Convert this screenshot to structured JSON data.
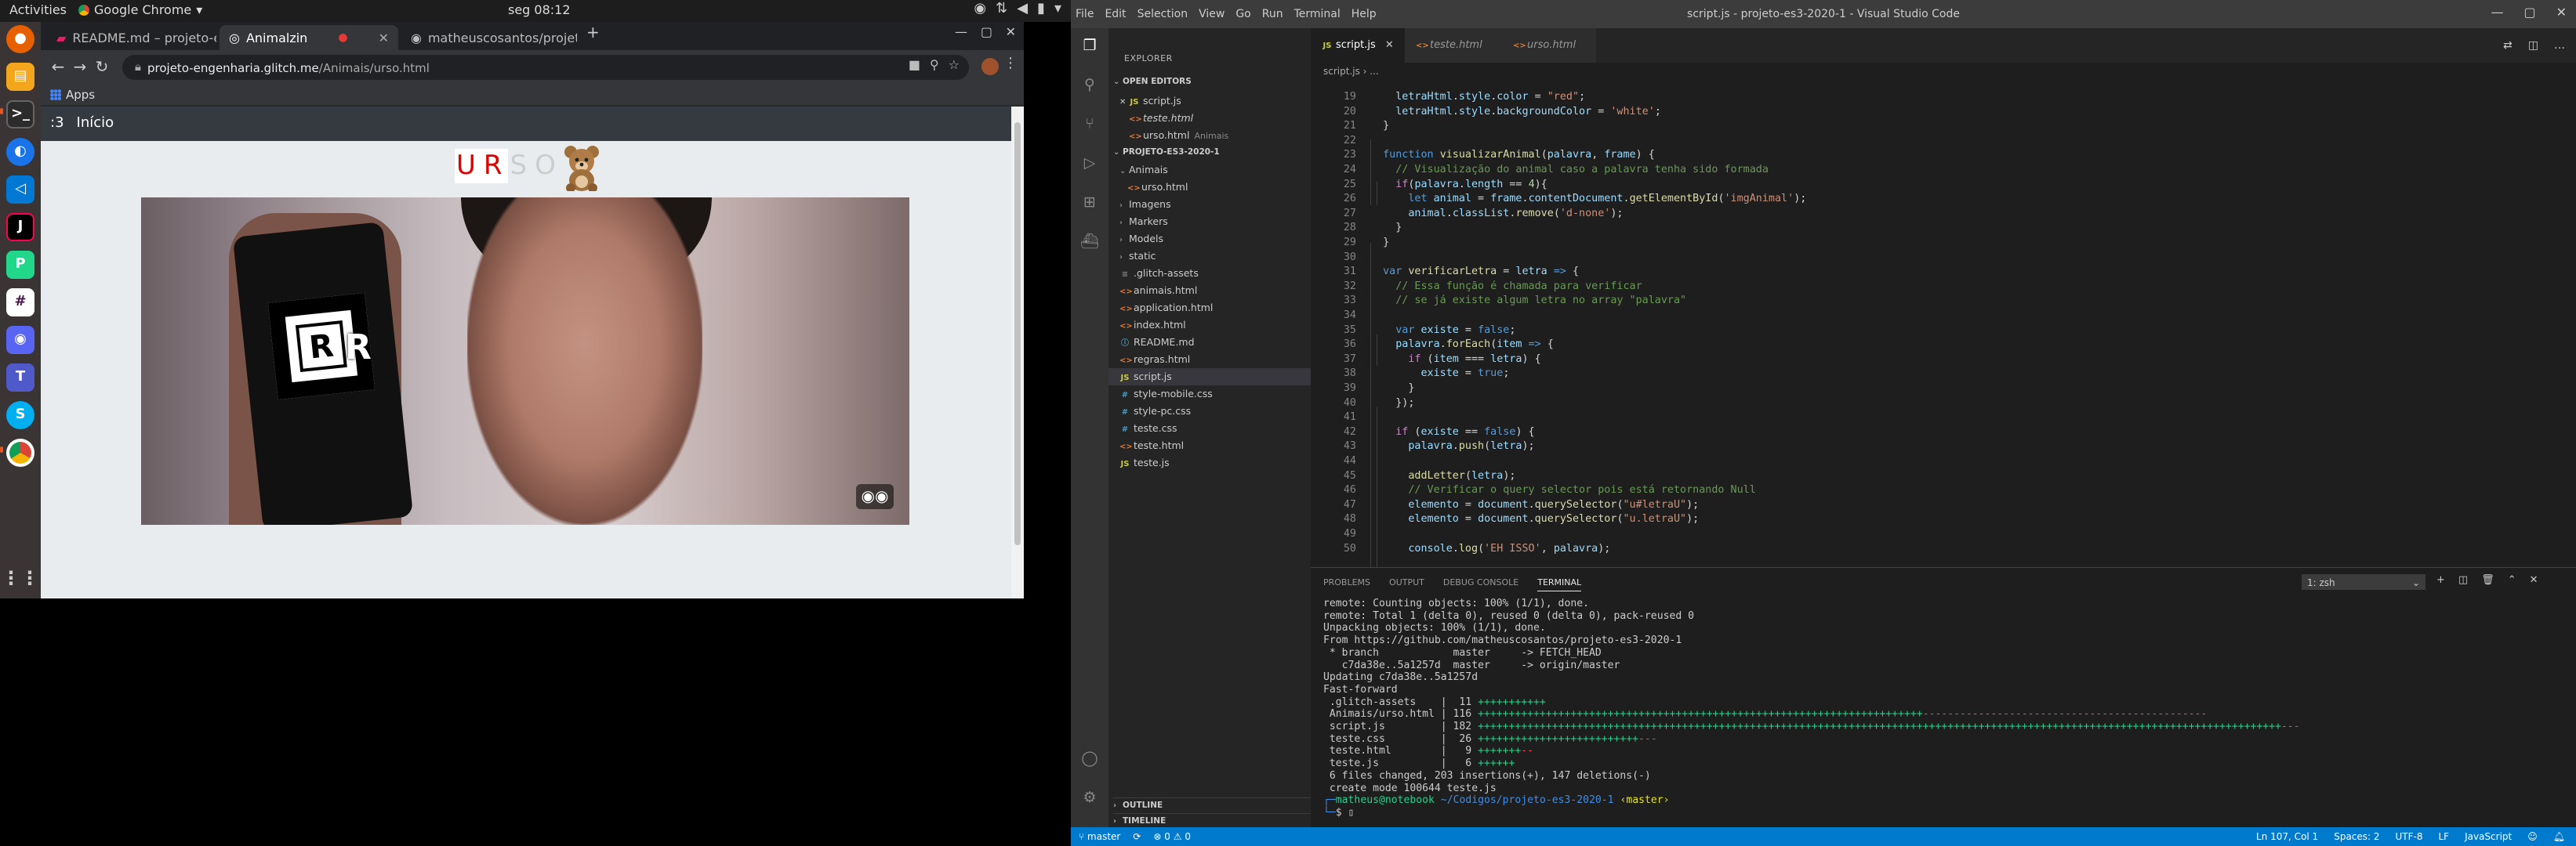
{
  "ubuntu": {
    "activities": "Activities",
    "app_name": "Google Chrome",
    "clock": "seg 08:12"
  },
  "chrome": {
    "tabs": [
      {
        "label": "README.md – projeto-en"
      },
      {
        "label": "Animalzin"
      },
      {
        "label": "matheuscosantos/projeto"
      }
    ],
    "url_host": "projeto-engenharia.glitch.me",
    "url_path": "/Animais/urso.html",
    "bookmarks_label": "Apps"
  },
  "webpage": {
    "nav_brand": ":3",
    "nav_link": "Início",
    "word_letters": [
      {
        "char": "U",
        "color": "#e00000"
      },
      {
        "char": "R",
        "color": "#e00000"
      },
      {
        "char": "S",
        "color": "#cccccc"
      },
      {
        "char": "O",
        "color": "#cccccc"
      }
    ],
    "ar_letter": "R",
    "marker_letter": "R",
    "vr_icon": "vr-goggles-icon"
  },
  "vscode": {
    "window_title": "script.js - projeto-es3-2020-1 - Visual Studio Code",
    "menu": [
      "File",
      "Edit",
      "Selection",
      "View",
      "Go",
      "Run",
      "Terminal",
      "Help"
    ],
    "explorer_title": "EXPLORER",
    "open_editors_title": "OPEN EDITORS",
    "open_editors": [
      {
        "name": "script.js",
        "type": "js",
        "extra": ""
      },
      {
        "name": "teste.html",
        "type": "html",
        "extra": ""
      },
      {
        "name": "urso.html",
        "type": "html",
        "extra": "Animais"
      }
    ],
    "project_title": "PROJETO-ES3-2020-1",
    "tree": [
      {
        "name": "Animais",
        "type": "folder",
        "depth": 0,
        "open": true
      },
      {
        "name": "urso.html",
        "type": "html",
        "depth": 1
      },
      {
        "name": "Imagens",
        "type": "folder",
        "depth": 0
      },
      {
        "name": "Markers",
        "type": "folder",
        "depth": 0
      },
      {
        "name": "Models",
        "type": "folder",
        "depth": 0
      },
      {
        "name": "static",
        "type": "folder",
        "depth": 0
      },
      {
        "name": ".glitch-assets",
        "type": "gen",
        "depth": 0
      },
      {
        "name": "animais.html",
        "type": "html",
        "depth": 0
      },
      {
        "name": "application.html",
        "type": "html",
        "depth": 0
      },
      {
        "name": "index.html",
        "type": "html",
        "depth": 0
      },
      {
        "name": "README.md",
        "type": "md",
        "depth": 0
      },
      {
        "name": "regras.html",
        "type": "html",
        "depth": 0
      },
      {
        "name": "script.js",
        "type": "js",
        "depth": 0,
        "selected": true
      },
      {
        "name": "style-mobile.css",
        "type": "css",
        "depth": 0
      },
      {
        "name": "style-pc.css",
        "type": "css",
        "depth": 0
      },
      {
        "name": "teste.css",
        "type": "css",
        "depth": 0
      },
      {
        "name": "teste.html",
        "type": "html",
        "depth": 0
      },
      {
        "name": "teste.js",
        "type": "js",
        "depth": 0
      }
    ],
    "outline_title": "OUTLINE",
    "timeline_title": "TIMELINE",
    "editor_tabs": [
      {
        "label": "script.js",
        "type": "js",
        "active": true
      },
      {
        "label": "teste.html",
        "type": "html",
        "active": false
      },
      {
        "label": "urso.html",
        "type": "html",
        "active": false
      }
    ],
    "breadcrumb": "script.js › ...",
    "panel_tabs": [
      "PROBLEMS",
      "OUTPUT",
      "DEBUG CONSOLE",
      "TERMINAL"
    ],
    "terminal_selector": "1: zsh",
    "status": {
      "branch": "master",
      "errors": "⊗ 0 ⚠ 0",
      "position": "Ln 107, Col 1",
      "spaces": "Spaces: 2",
      "encoding": "UTF-8",
      "eol": "LF",
      "language": "JavaScript"
    }
  }
}
